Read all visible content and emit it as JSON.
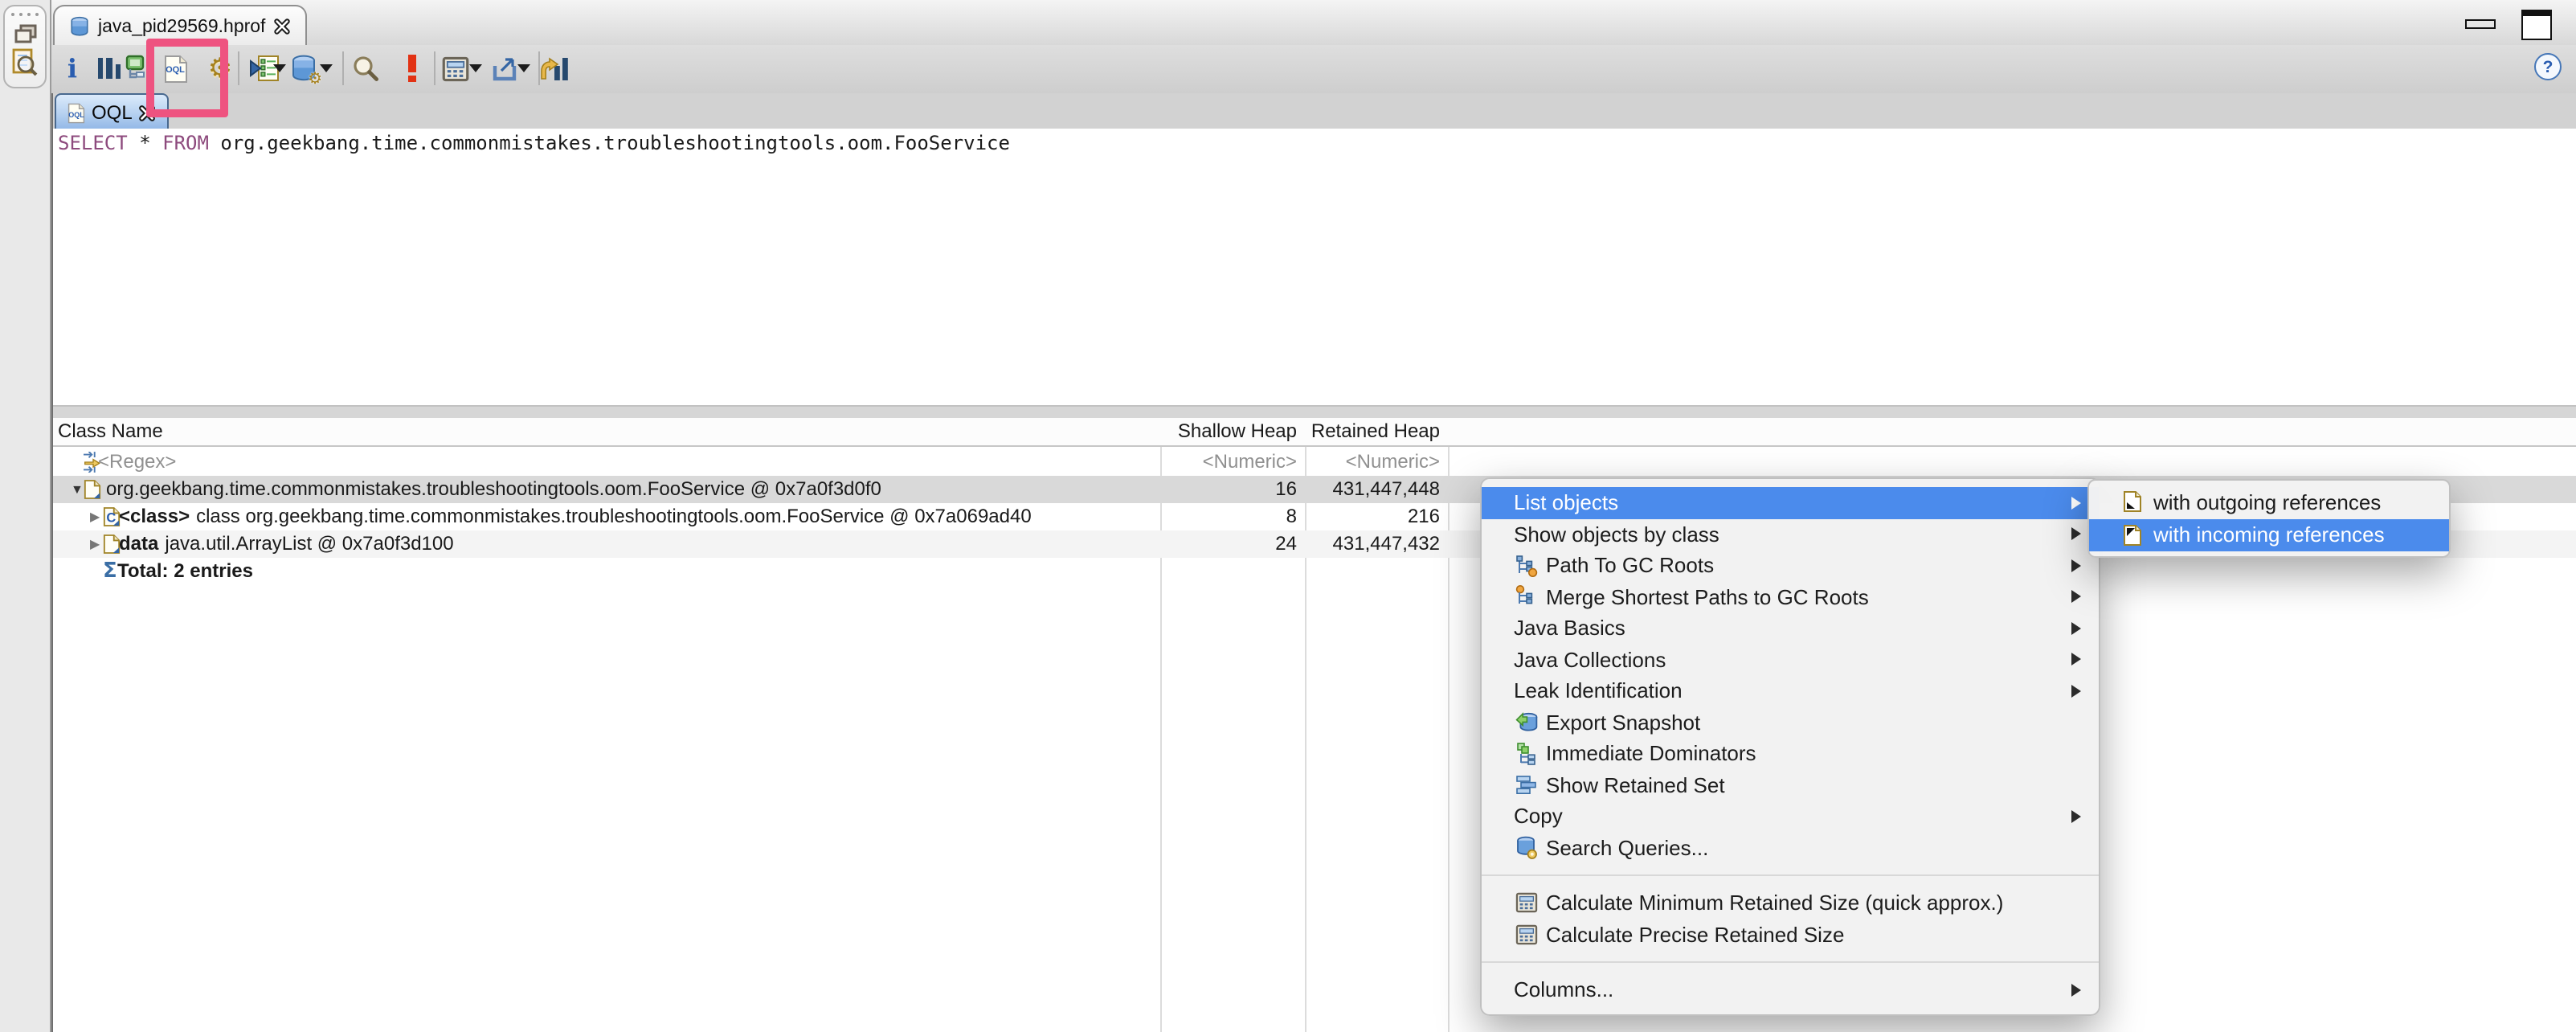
{
  "window": {
    "file_tab_label": "java_pid29569.hprof",
    "oql_tab_label": "OQL"
  },
  "icons": {
    "info": "i",
    "oql": "OQL",
    "help": "?",
    "sigma": "Σ"
  },
  "oql": {
    "query": {
      "select": "SELECT",
      "star": "*",
      "from": "FROM",
      "target": "org.geekbang.time.commonmistakes.troubleshootingtools.oom.FooService"
    }
  },
  "table": {
    "columns": [
      "Class Name",
      "Shallow Heap",
      "Retained Heap"
    ],
    "filter": {
      "class_name": "<Regex>",
      "shallow": "<Numeric>",
      "retained": "<Numeric>"
    },
    "rows": [
      {
        "expand": "▼",
        "label": "org.geekbang.time.commonmistakes.troubleshootingtools.oom.FooService @ 0x7a0f3d0f0",
        "shallow": "16",
        "retained": "431,447,448"
      },
      {
        "expand": "▶",
        "bold": "<class>",
        "label": "class org.geekbang.time.commonmistakes.troubleshootingtools.oom.FooService @ 0x7a069ad40",
        "shallow": "8",
        "retained": "216"
      },
      {
        "expand": "▶",
        "bold": "data",
        "label": "java.util.ArrayList @ 0x7a0f3d100",
        "shallow": "24",
        "retained": "431,447,432"
      },
      {
        "bold": "Total: 2 entries"
      }
    ]
  },
  "context_menu": {
    "items": [
      {
        "label": "List objects"
      },
      {
        "label": "Show objects by class"
      },
      {
        "label": "Path To GC Roots"
      },
      {
        "label": "Merge Shortest Paths to GC Roots"
      },
      {
        "label": "Java Basics"
      },
      {
        "label": "Java Collections"
      },
      {
        "label": "Leak Identification"
      },
      {
        "label": "Export Snapshot"
      },
      {
        "label": "Immediate Dominators"
      },
      {
        "label": "Show Retained Set"
      },
      {
        "label": "Copy"
      },
      {
        "label": "Search Queries..."
      },
      {
        "label": "Calculate Minimum Retained Size (quick approx.)"
      },
      {
        "label": "Calculate Precise Retained Size"
      },
      {
        "label": "Columns..."
      }
    ]
  },
  "submenu": {
    "items": [
      {
        "label": "with outgoing references"
      },
      {
        "label": "with incoming references"
      }
    ]
  },
  "colors": {
    "selection_blue": "#4b8bec",
    "annotation_pink": "#ee5380",
    "keyword_purple": "#8d4a7d",
    "tab_blue": "#8fb6e6",
    "selected_row_gray": "#d9d9d9"
  }
}
